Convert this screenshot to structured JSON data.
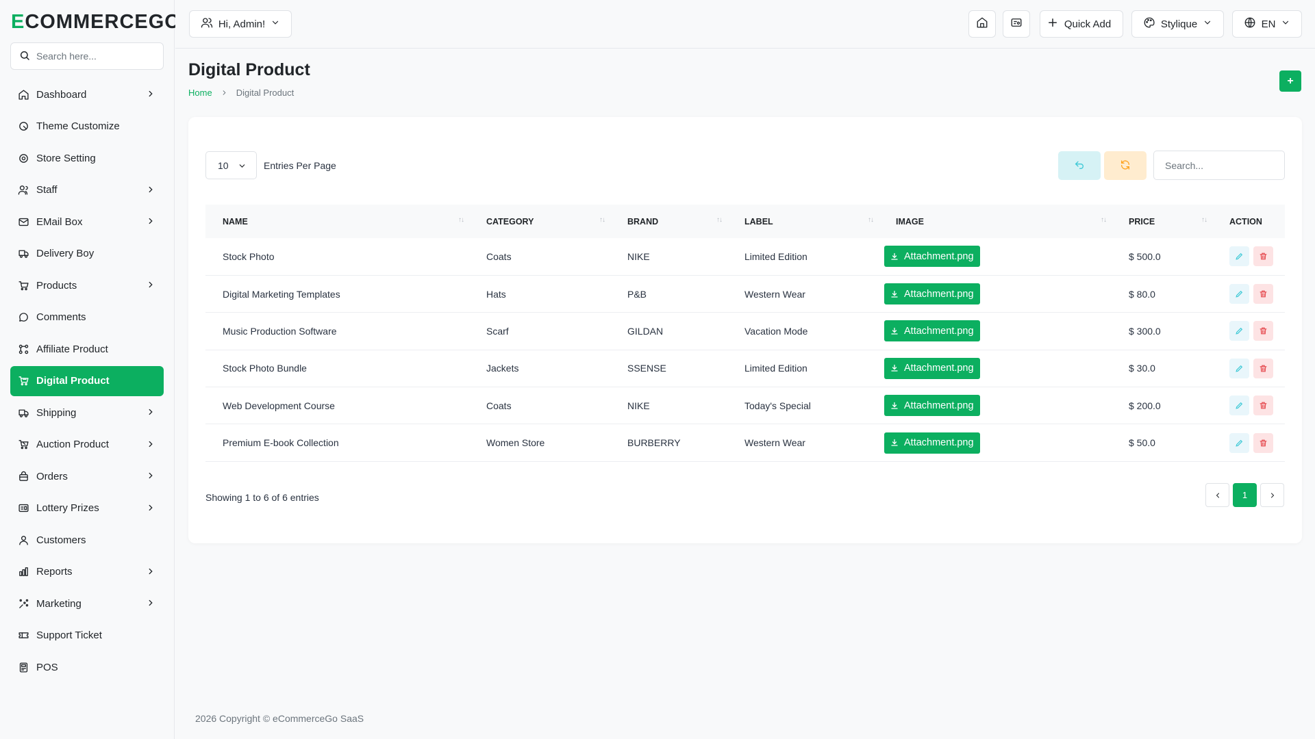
{
  "brand": {
    "logo_first": "E",
    "logo_rest": "COMMERCEGO"
  },
  "sidebar": {
    "search_placeholder": "Search here...",
    "items": [
      {
        "label": "Dashboard",
        "icon": "home-icon",
        "chevron": true
      },
      {
        "label": "Theme Customize",
        "icon": "palette-icon",
        "chevron": false
      },
      {
        "label": "Store Setting",
        "icon": "settings-icon",
        "chevron": false
      },
      {
        "label": "Staff",
        "icon": "users-icon",
        "chevron": true
      },
      {
        "label": "EMail Box",
        "icon": "mail-icon",
        "chevron": true
      },
      {
        "label": "Delivery Boy",
        "icon": "truck-icon",
        "chevron": false
      },
      {
        "label": "Products",
        "icon": "cart-icon",
        "chevron": true
      },
      {
        "label": "Comments",
        "icon": "comment-icon",
        "chevron": false
      },
      {
        "label": "Affiliate Product",
        "icon": "affiliate-icon",
        "chevron": false
      },
      {
        "label": "Digital Product",
        "icon": "digital-cart-icon",
        "chevron": false,
        "active": true
      },
      {
        "label": "Shipping",
        "icon": "shipping-icon",
        "chevron": true
      },
      {
        "label": "Auction Product",
        "icon": "auction-icon",
        "chevron": true
      },
      {
        "label": "Orders",
        "icon": "orders-icon",
        "chevron": true
      },
      {
        "label": "Lottery Prizes",
        "icon": "lottery-icon",
        "chevron": true
      },
      {
        "label": "Customers",
        "icon": "user-icon",
        "chevron": false
      },
      {
        "label": "Reports",
        "icon": "chart-icon",
        "chevron": true
      },
      {
        "label": "Marketing",
        "icon": "marketing-icon",
        "chevron": true
      },
      {
        "label": "Support Ticket",
        "icon": "ticket-icon",
        "chevron": false
      },
      {
        "label": "POS",
        "icon": "pos-icon",
        "chevron": false
      }
    ]
  },
  "header": {
    "greeting": "Hi, Admin!",
    "quick_add": "Quick Add",
    "store_name": "Stylique",
    "language": "EN"
  },
  "page": {
    "title": "Digital Product",
    "breadcrumb_home": "Home",
    "breadcrumb_current": "Digital Product",
    "add_label": "+"
  },
  "table": {
    "page_size": "10",
    "entries_label": "Entries Per Page",
    "search_placeholder": "Search...",
    "sort_glyph": "↑↓",
    "columns": [
      "Name",
      "Category",
      "Brand",
      "Label",
      "Image",
      "Price",
      "Action"
    ],
    "rows": [
      {
        "name": "Stock Photo",
        "category": "Coats",
        "brand": "NIKE",
        "label": "Limited Edition",
        "image": "Attachment.png",
        "price": "$ 500.0"
      },
      {
        "name": "Digital Marketing Templates",
        "category": "Hats",
        "brand": "P&B",
        "label": "Western Wear",
        "image": "Attachment.png",
        "price": "$ 80.0"
      },
      {
        "name": "Music Production Software",
        "category": "Scarf",
        "brand": "GILDAN",
        "label": "Vacation Mode",
        "image": "Attachment.png",
        "price": "$ 300.0"
      },
      {
        "name": "Stock Photo Bundle",
        "category": "Jackets",
        "brand": "SSENSE",
        "label": "Limited Edition",
        "image": "Attachment.png",
        "price": "$ 30.0"
      },
      {
        "name": "Web Development Course",
        "category": "Coats",
        "brand": "NIKE",
        "label": "Today's Special",
        "image": "Attachment.png",
        "price": "$ 200.0"
      },
      {
        "name": "Premium E-book Collection",
        "category": "Women Store",
        "brand": "BURBERRY",
        "label": "Western Wear",
        "image": "Attachment.png",
        "price": "$ 50.0"
      }
    ],
    "showing": "Showing 1 to 6 of 6 entries",
    "current_page": "1"
  },
  "footer": {
    "copyright": "2026 Copyright © eCommerceGo SaaS"
  },
  "colors": {
    "accent": "#0caf60",
    "danger": "#e5484d",
    "info": "#3ec9d6",
    "warning": "#ffa21d"
  }
}
